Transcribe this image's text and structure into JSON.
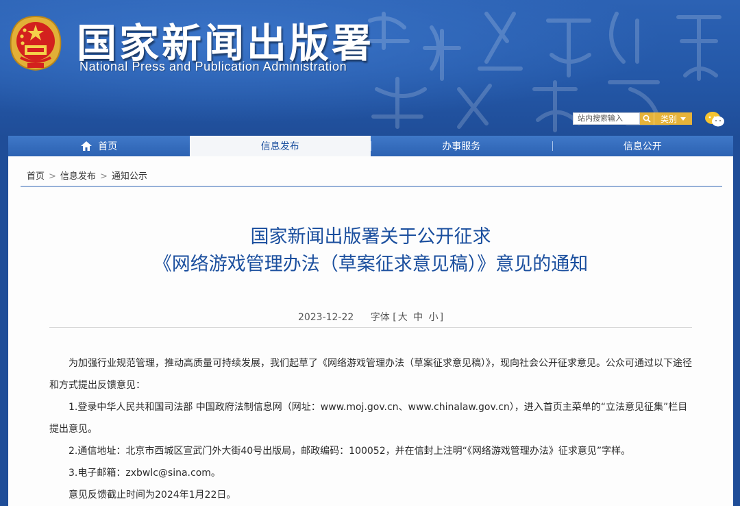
{
  "header": {
    "title": "国家新闻出版署",
    "subtitle": "National  Press and Publication Administration",
    "search_placeholder": "站内搜索输入",
    "category_label": "类别",
    "colors": {
      "banner": "#2458a8",
      "accent_gold": "#e6b33a",
      "title_blue": "#1b4f9e"
    },
    "icons": [
      "national-emblem-icon",
      "search-icon",
      "wechat-icon",
      "home-icon"
    ]
  },
  "nav": {
    "items": [
      {
        "label": "首页"
      },
      {
        "label": "信息发布"
      },
      {
        "label": "办事服务"
      },
      {
        "label": "信息公开"
      }
    ],
    "active_index": 1
  },
  "breadcrumb": {
    "items": [
      "首页",
      "信息发布",
      "通知公示"
    ],
    "separator": ">"
  },
  "article": {
    "title_line1": "国家新闻出版署关于公开征求",
    "title_line2": "《网络游戏管理办法（草案征求意见稿）》意见的通知",
    "date": "2023-12-22",
    "font_label": "字体",
    "font_bracket_open": "[",
    "font_large": "大",
    "font_medium": "中",
    "font_small": "小",
    "font_bracket_close": "]",
    "paragraphs": [
      "为加强行业规范管理，推动高质量可持续发展，我们起草了《网络游戏管理办法（草案征求意见稿）》，现向社会公开征求意见。公众可通过以下途径和方式提出反馈意见：",
      "1.登录中华人民共和国司法部 中国政府法制信息网（网址：www.moj.gov.cn、www.chinalaw.gov.cn），进入首页主菜单的“立法意见征集”栏目提出意见。",
      "2.通信地址：北京市西城区宣武门外大街40号出版局，邮政编码：100052，并在信封上注明“《网络游戏管理办法》征求意见”字样。",
      "3.电子邮箱：zxbwlc@sina.com。",
      "意见反馈截止时间为2024年1月22日。"
    ]
  }
}
